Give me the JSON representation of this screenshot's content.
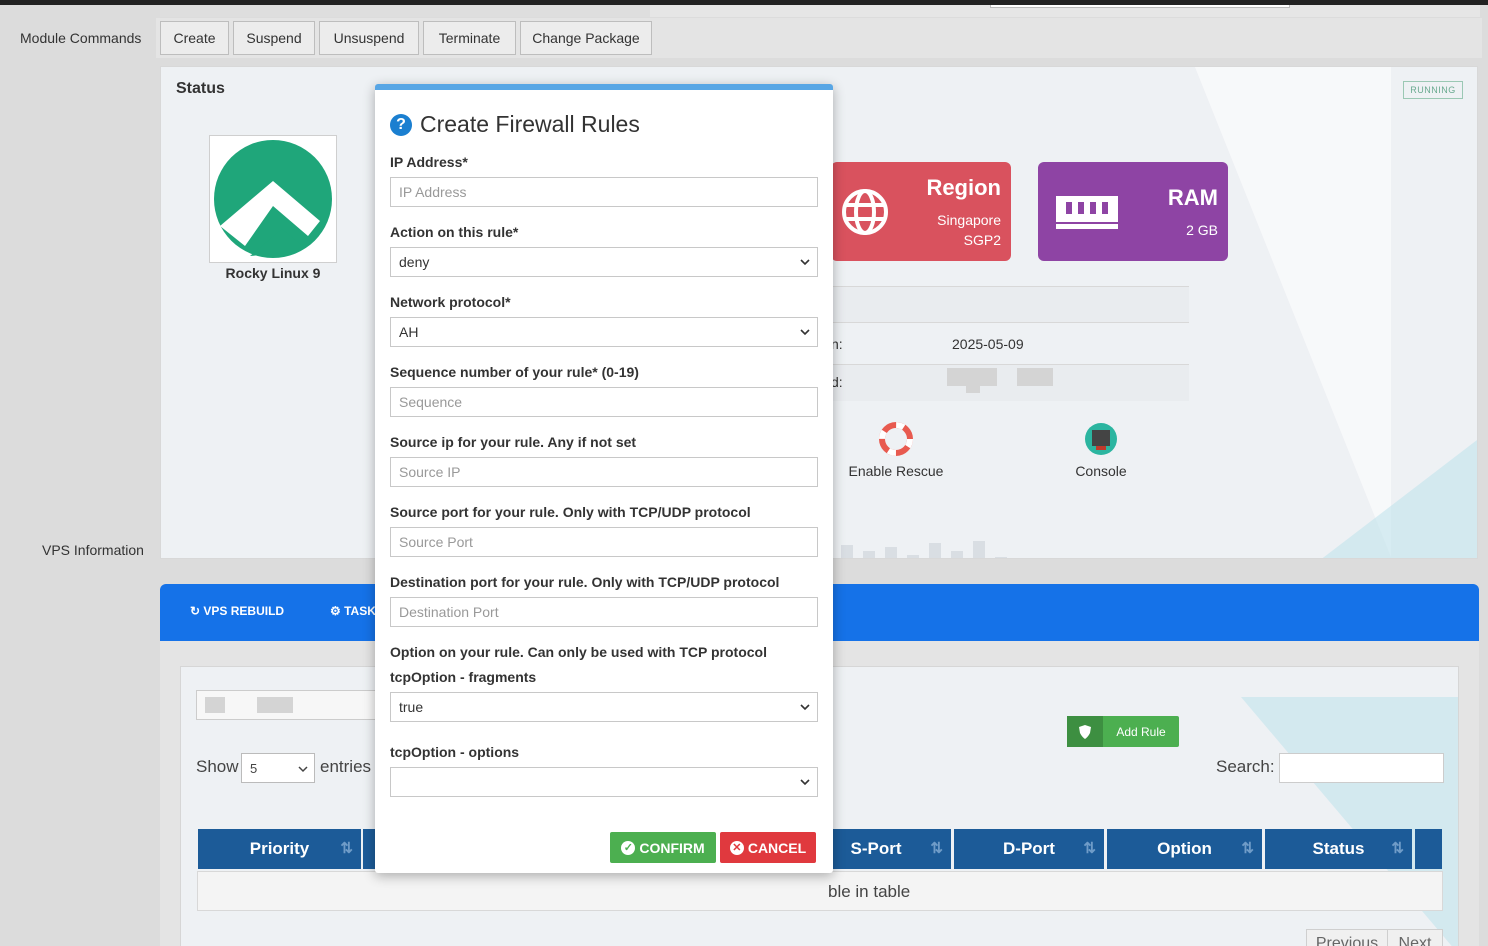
{
  "left_labels": {
    "module_commands": "Module Commands",
    "vps_information": "VPS Information"
  },
  "module_buttons": [
    "Create",
    "Suspend",
    "Unsuspend",
    "Terminate",
    "Change Package"
  ],
  "status": {
    "title": "Status",
    "badge": "RUNNING",
    "os_name": "Rocky Linux 9",
    "region_card": {
      "title": "Region",
      "line1": "Singapore",
      "line2": "SGP2",
      "color": "#d9525e"
    },
    "ram_card": {
      "title": "RAM",
      "value": "2 GB",
      "color": "#8e44a4"
    },
    "info_rows": [
      {
        "label_fragment": "n:",
        "value": "2025-05-09"
      },
      {
        "label_fragment": "d:",
        "value": ""
      }
    ],
    "actions": {
      "rescue": "Enable Rescue",
      "console": "Console"
    }
  },
  "tabs_bar": {
    "rebuild": "VPS REBUILD",
    "tasks": "TASK",
    "color": "#1572e8"
  },
  "firewall_table": {
    "add_rule": "Add Rule",
    "show_label": "Show",
    "entries_label": "entries",
    "page_length": "5",
    "search_label": "Search:",
    "columns": [
      "Priority",
      "S-Port",
      "D-Port",
      "Option",
      "Status"
    ],
    "empty_text_fragment": "ble in table",
    "prev": "Previous",
    "next": "Next"
  },
  "modal": {
    "title": "Create Firewall Rules",
    "fields": {
      "ip_label": "IP Address*",
      "ip_placeholder": "IP Address",
      "action_label": "Action on this rule*",
      "action_value": "deny",
      "protocol_label": "Network protocol*",
      "protocol_value": "AH",
      "seq_label": "Sequence number of your rule* (0-19)",
      "seq_placeholder": "Sequence",
      "srcip_label": "Source ip for your rule. Any if not set",
      "srcip_placeholder": "Source IP",
      "srcport_label": "Source port for your rule. Only with TCP/UDP protocol",
      "srcport_placeholder": "Source Port",
      "dstport_label": "Destination port for your rule. Only with TCP/UDP protocol",
      "dstport_placeholder": "Destination Port",
      "option_label": "Option on your rule. Can only be used with TCP protocol",
      "fragments_label": "tcpOption - fragments",
      "fragments_value": "true",
      "options_label": "tcpOption - options",
      "options_value": ""
    },
    "confirm": "CONFIRM",
    "cancel": "CANCEL",
    "confirm_color": "#4caf50",
    "cancel_color": "#e0393e"
  }
}
